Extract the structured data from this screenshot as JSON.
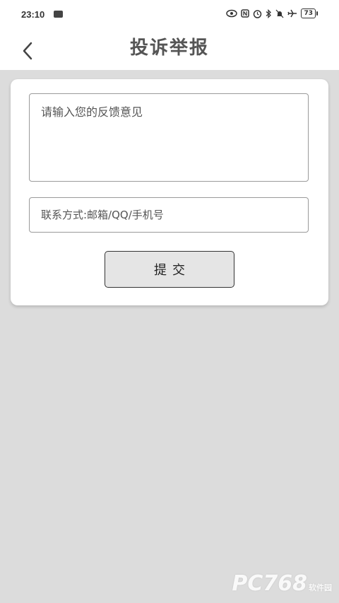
{
  "status_bar": {
    "time": "23:10",
    "battery": "73",
    "icons": [
      "eye-icon",
      "nfc-icon",
      "alarm-icon",
      "bluetooth-icon",
      "mute-icon",
      "airplane-icon"
    ]
  },
  "header": {
    "title": "投诉举报",
    "back_icon": "chevron-left-icon"
  },
  "form": {
    "feedback_placeholder": "请输入您的反馈意见",
    "contact_placeholder": "联系方式:邮箱/QQ/手机号",
    "submit_label": "提交"
  },
  "watermark": {
    "text": "PC768",
    "small": "软件园"
  },
  "colors": {
    "background": "#dcdcdc",
    "card": "#ffffff",
    "button": "#e5e5e5"
  }
}
